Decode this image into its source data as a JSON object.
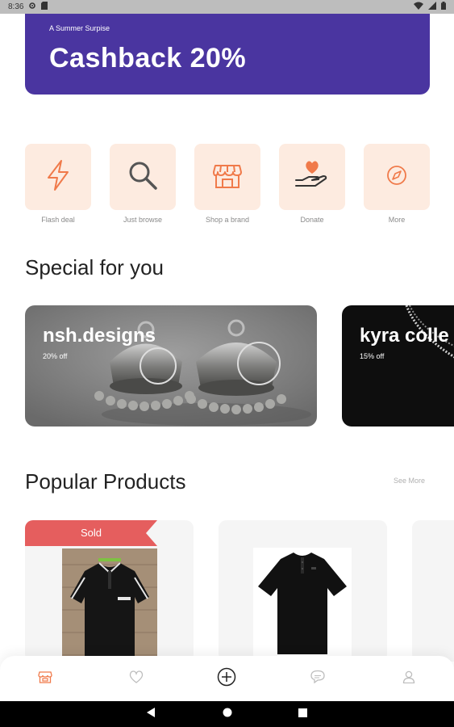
{
  "status_bar": {
    "time": "8:36"
  },
  "banner": {
    "subtitle": "A Summer Surpise",
    "title": "Cashback 20%",
    "color": "#4a35a0"
  },
  "categories": [
    {
      "label": "Flash deal",
      "icon": "flash-icon"
    },
    {
      "label": "Just browse",
      "icon": "search-icon"
    },
    {
      "label": "Shop a brand",
      "icon": "store-icon"
    },
    {
      "label": "Donate",
      "icon": "donate-hand-heart-icon"
    },
    {
      "label": "More",
      "icon": "compass-icon"
    }
  ],
  "special": {
    "title": "Special for you",
    "items": [
      {
        "name": "nsh.designs",
        "offer": "20% off"
      },
      {
        "name": "kyra colle",
        "offer": "15% off"
      }
    ]
  },
  "popular": {
    "title": "Popular Products",
    "see_more": "See More",
    "sold_label": "Sold"
  },
  "bottom_nav": [
    "store-icon",
    "heart-icon",
    "add-circle-icon",
    "chat-icon",
    "profile-icon"
  ],
  "colors": {
    "accent": "#f07a4a",
    "sold": "#e55e5e",
    "category_bg": "#fdebe0"
  }
}
